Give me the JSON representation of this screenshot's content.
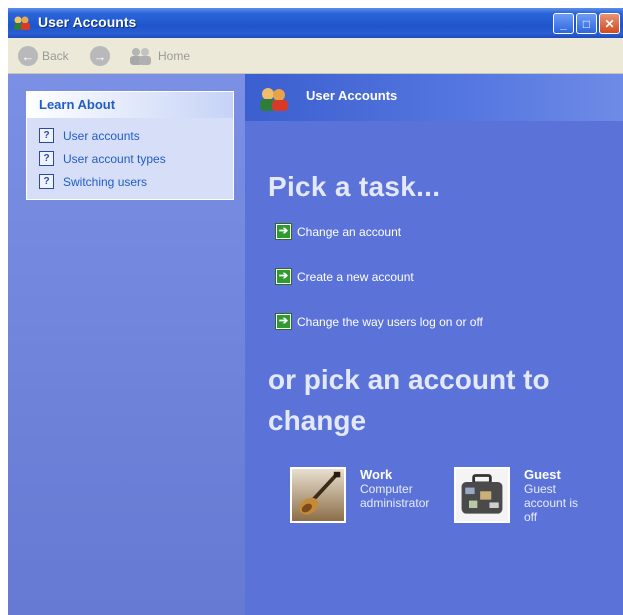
{
  "window": {
    "title": "User Accounts",
    "controls": {
      "minimize": "_",
      "maximize": "□",
      "close": "✕"
    }
  },
  "toolbar": {
    "back_label": "Back",
    "forward_label": "",
    "home_label": "Home"
  },
  "learn_about": {
    "header": "Learn About",
    "items": [
      {
        "label": "User accounts"
      },
      {
        "label": "User account types"
      },
      {
        "label": "Switching users"
      }
    ]
  },
  "main": {
    "header_title": "User Accounts",
    "pick_task": "Pick a task...",
    "tasks": [
      {
        "label": "Change an account"
      },
      {
        "label": "Create a new account"
      },
      {
        "label": "Change the way users log on or off"
      }
    ],
    "or_pick": "or pick an account to change",
    "accounts": [
      {
        "name": "Work",
        "description": "Computer administrator",
        "icon": "guitar-picture-icon"
      },
      {
        "name": "Guest",
        "description": "Guest account is off",
        "icon": "suitcase-picture-icon"
      }
    ]
  },
  "colors": {
    "titlebar": "#2b64d8",
    "left_pane": "#7b90e4",
    "right_pane": "#5b73d8",
    "link": "#215dc6",
    "task_arrow": "#2e9b2e"
  }
}
